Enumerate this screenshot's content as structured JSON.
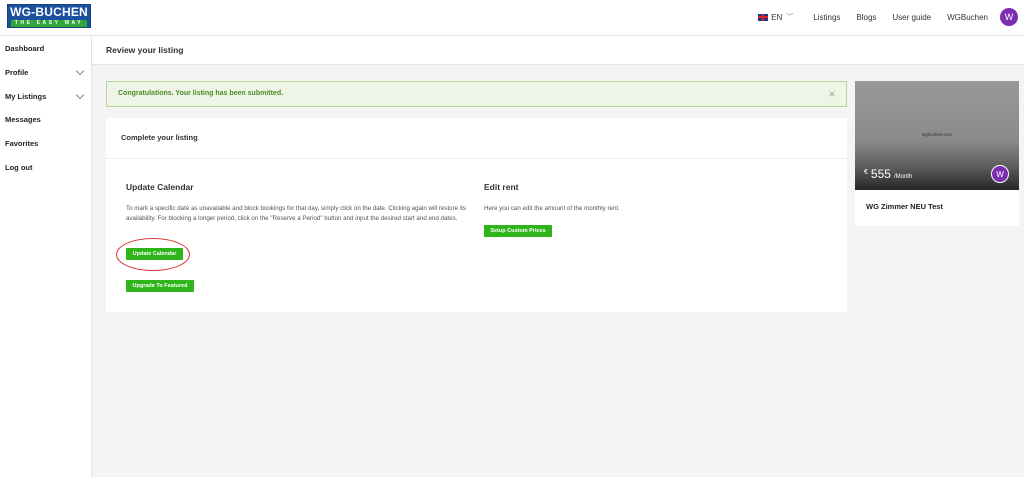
{
  "logo": {
    "main": "WG-BUCHEN",
    "sub": "THE EASY WAY"
  },
  "nav": {
    "language": "EN",
    "links": [
      "Listings",
      "Blogs",
      "User guide",
      "WGBuchen"
    ],
    "avatar_letter": "W"
  },
  "sidebar": {
    "items": [
      {
        "label": "Dashboard",
        "has_chevron": false
      },
      {
        "label": "Profile",
        "has_chevron": true
      },
      {
        "label": "My Listings",
        "has_chevron": true
      },
      {
        "label": "Messages",
        "has_chevron": false
      },
      {
        "label": "Favorites",
        "has_chevron": false
      },
      {
        "label": "Log out",
        "has_chevron": false
      }
    ]
  },
  "page": {
    "title": "Review your listing"
  },
  "alert": {
    "text": "Congratulations. Your listing has been submitted.",
    "close": "×"
  },
  "card": {
    "title": "Complete your listing",
    "calendar": {
      "title": "Update Calendar",
      "text": "To mark a specific date as unavailable and block bookings for that day, simply click on the date. Clicking again will restore its availability. For blocking a longer period, click on the \"Reserve a Period\" button and input the desired start and end dates.",
      "button": "Update Calendar",
      "featured_button": "Upgrade To Featured"
    },
    "rent": {
      "title": "Edit rent",
      "text": "Here you can edit the amount of the monthly rent.",
      "button": "Setup Custom Prices"
    }
  },
  "preview": {
    "watermark": "wgbuchen.com",
    "currency": "€",
    "price": "555",
    "period": "/Month",
    "avatar_letter": "W",
    "name": "WG Zimmer NEU Test"
  },
  "colors": {
    "accent_green": "#2fb51a",
    "brand_blue": "#1c4f9e",
    "avatar_purple": "#7b2fb0",
    "highlight_red": "#d63333"
  }
}
